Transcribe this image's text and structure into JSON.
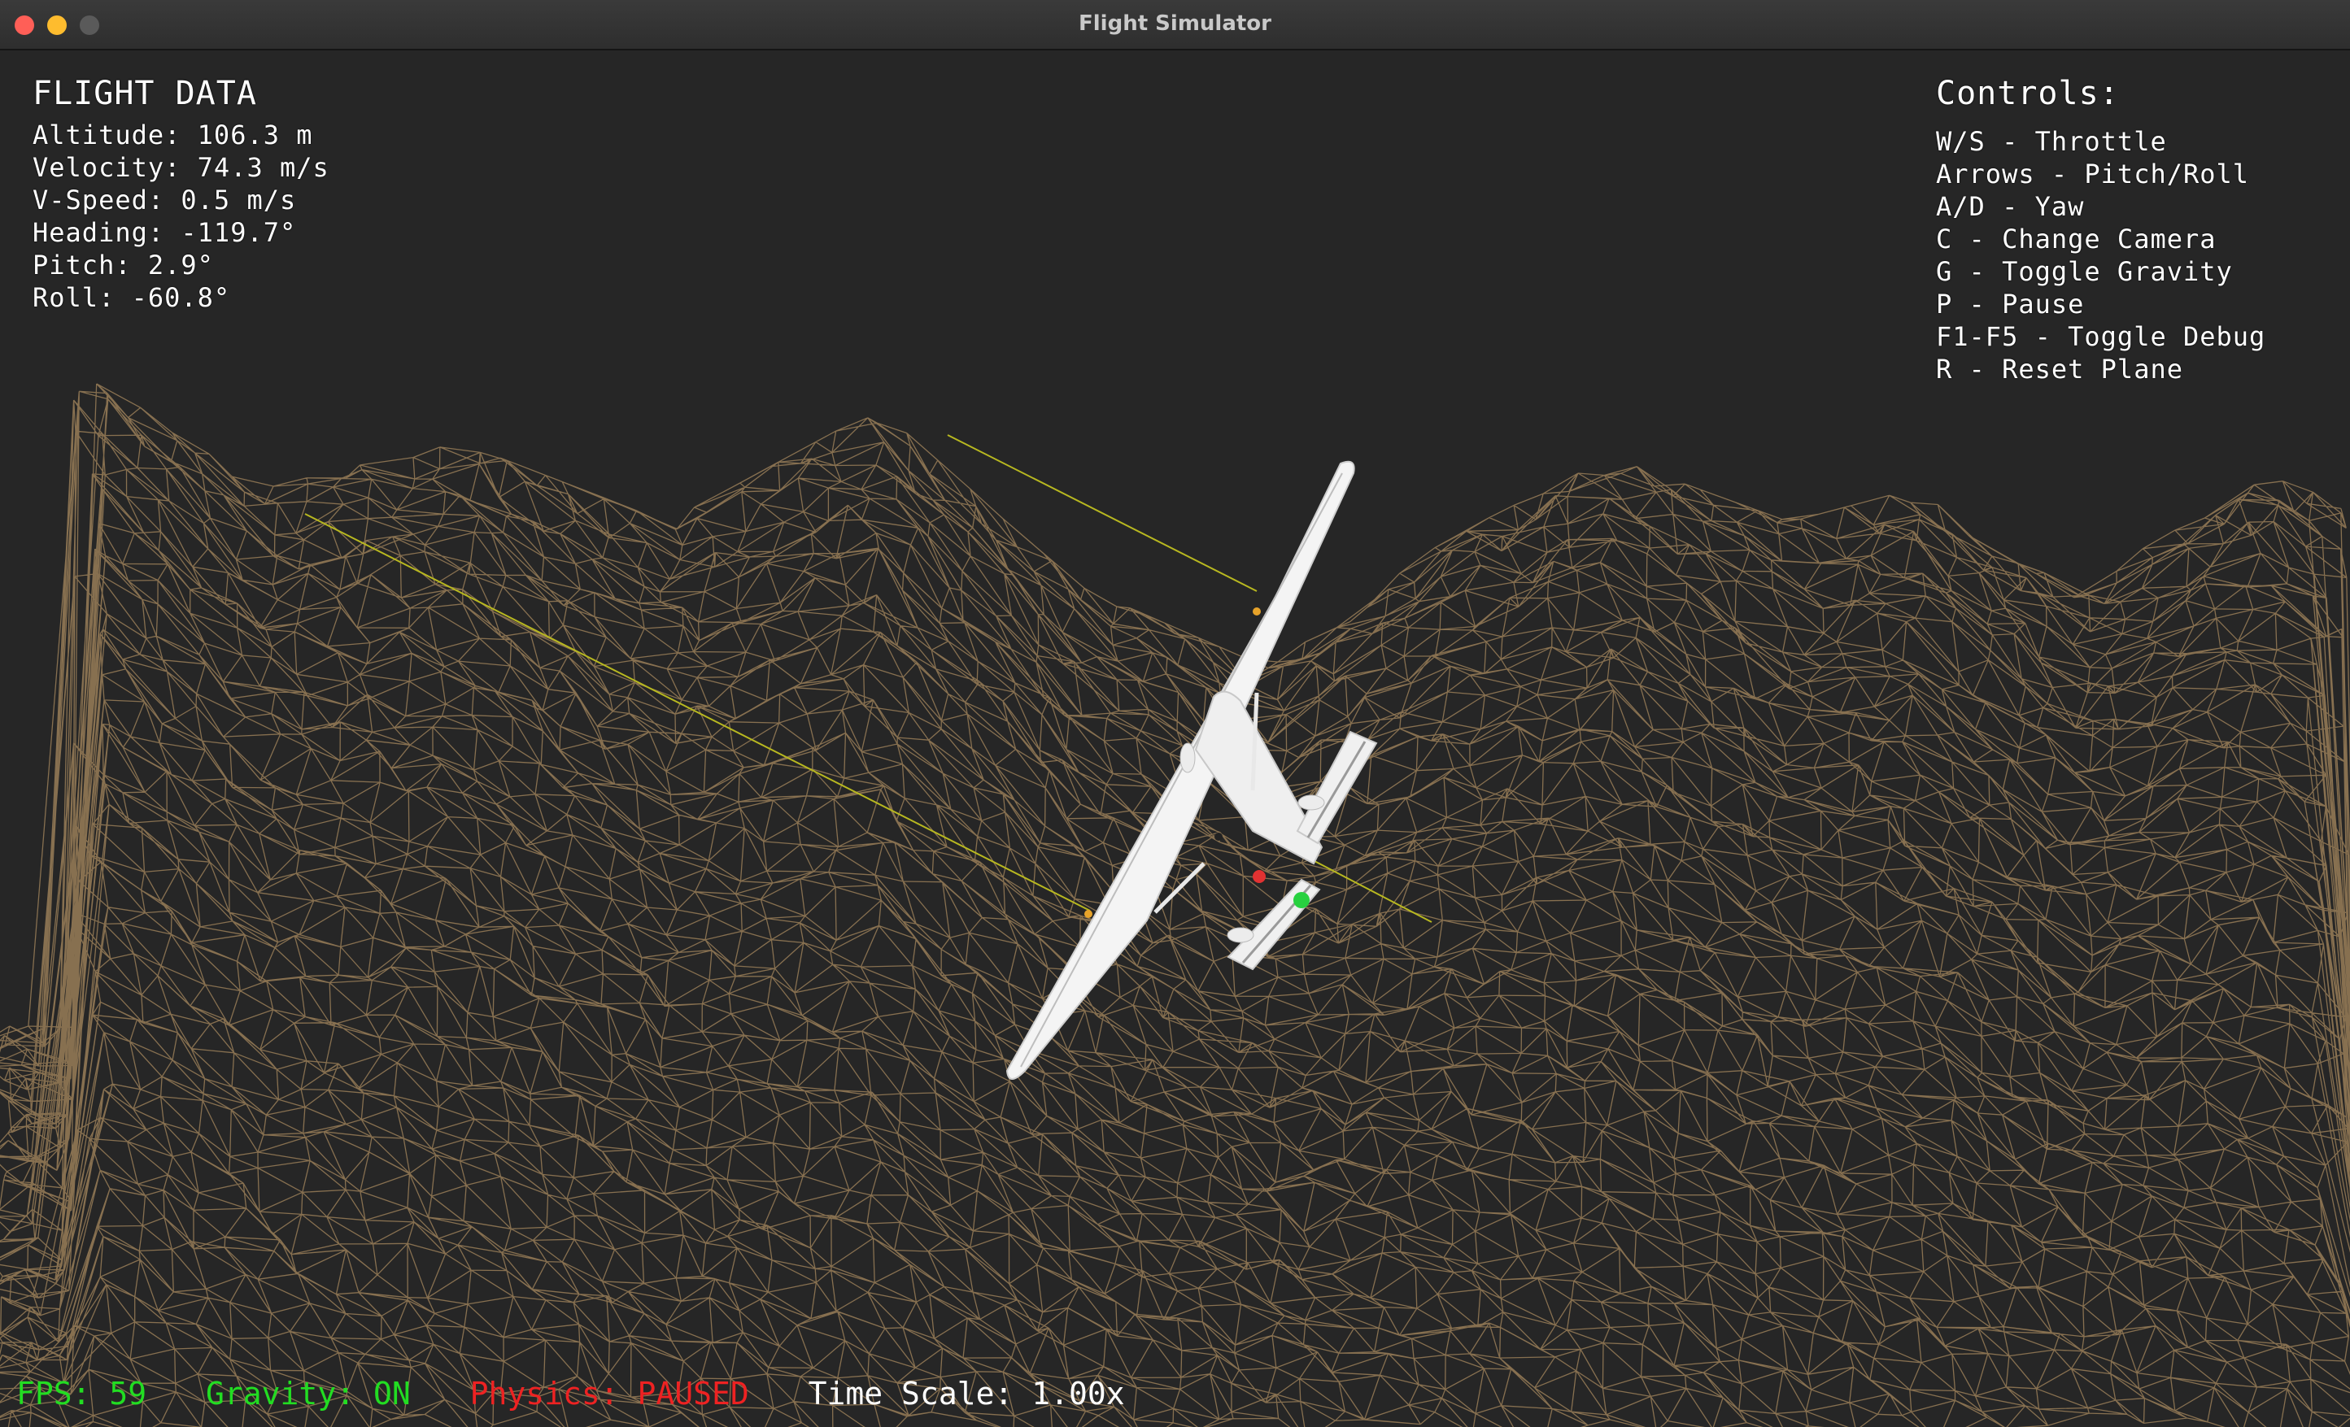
{
  "window": {
    "title": "Flight Simulator"
  },
  "flight_data": {
    "heading": "FLIGHT DATA",
    "lines": [
      "Altitude: 106.3 m",
      "Velocity: 74.3 m/s",
      "V-Speed: 0.5 m/s",
      "Heading: -119.7°",
      "Pitch: 2.9°",
      "Roll: -60.8°"
    ]
  },
  "controls": {
    "heading": "Controls:",
    "lines": [
      "W/S - Throttle",
      "Arrows - Pitch/Roll",
      "A/D - Yaw",
      "C - Change Camera",
      "G - Toggle Gravity",
      "P - Pause",
      "F1-F5 - Toggle Debug",
      "R - Reset Plane"
    ]
  },
  "status_bar": {
    "fps": "FPS: 59",
    "gravity": "Gravity: ON",
    "physics": "Physics: PAUSED",
    "time_scale": "Time Scale: 1.00x"
  },
  "colors": {
    "background": "#262626",
    "terrain_wire": "#a88a5f",
    "fps": "#22dd22",
    "gravity": "#22dd22",
    "physics": "#ee2222",
    "time_scale": "#ffffff",
    "debug_line": "#b8b820",
    "plane": "#f2f2f2"
  }
}
